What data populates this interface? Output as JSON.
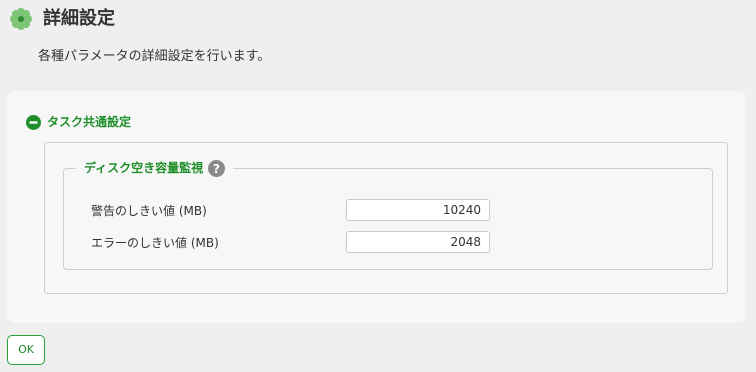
{
  "header": {
    "title": "詳細設定",
    "icon": "gear-icon",
    "icon_color": "#5cb85c"
  },
  "description": "各種パラメータの詳細設定を行います。",
  "section": {
    "label": "タスク共通設定",
    "toggle_icon": "minus-circle-icon",
    "accent_color": "#1f8f2a",
    "expanded": true,
    "fieldset": {
      "legend": "ディスク空き容量監視",
      "help_icon": "question-circle-icon",
      "rows": [
        {
          "label": "警告のしきい値 (MB)",
          "value": "10240"
        },
        {
          "label": "エラーのしきい値 (MB)",
          "value": "2048"
        }
      ]
    }
  },
  "footer": {
    "ok_label": "OK"
  }
}
